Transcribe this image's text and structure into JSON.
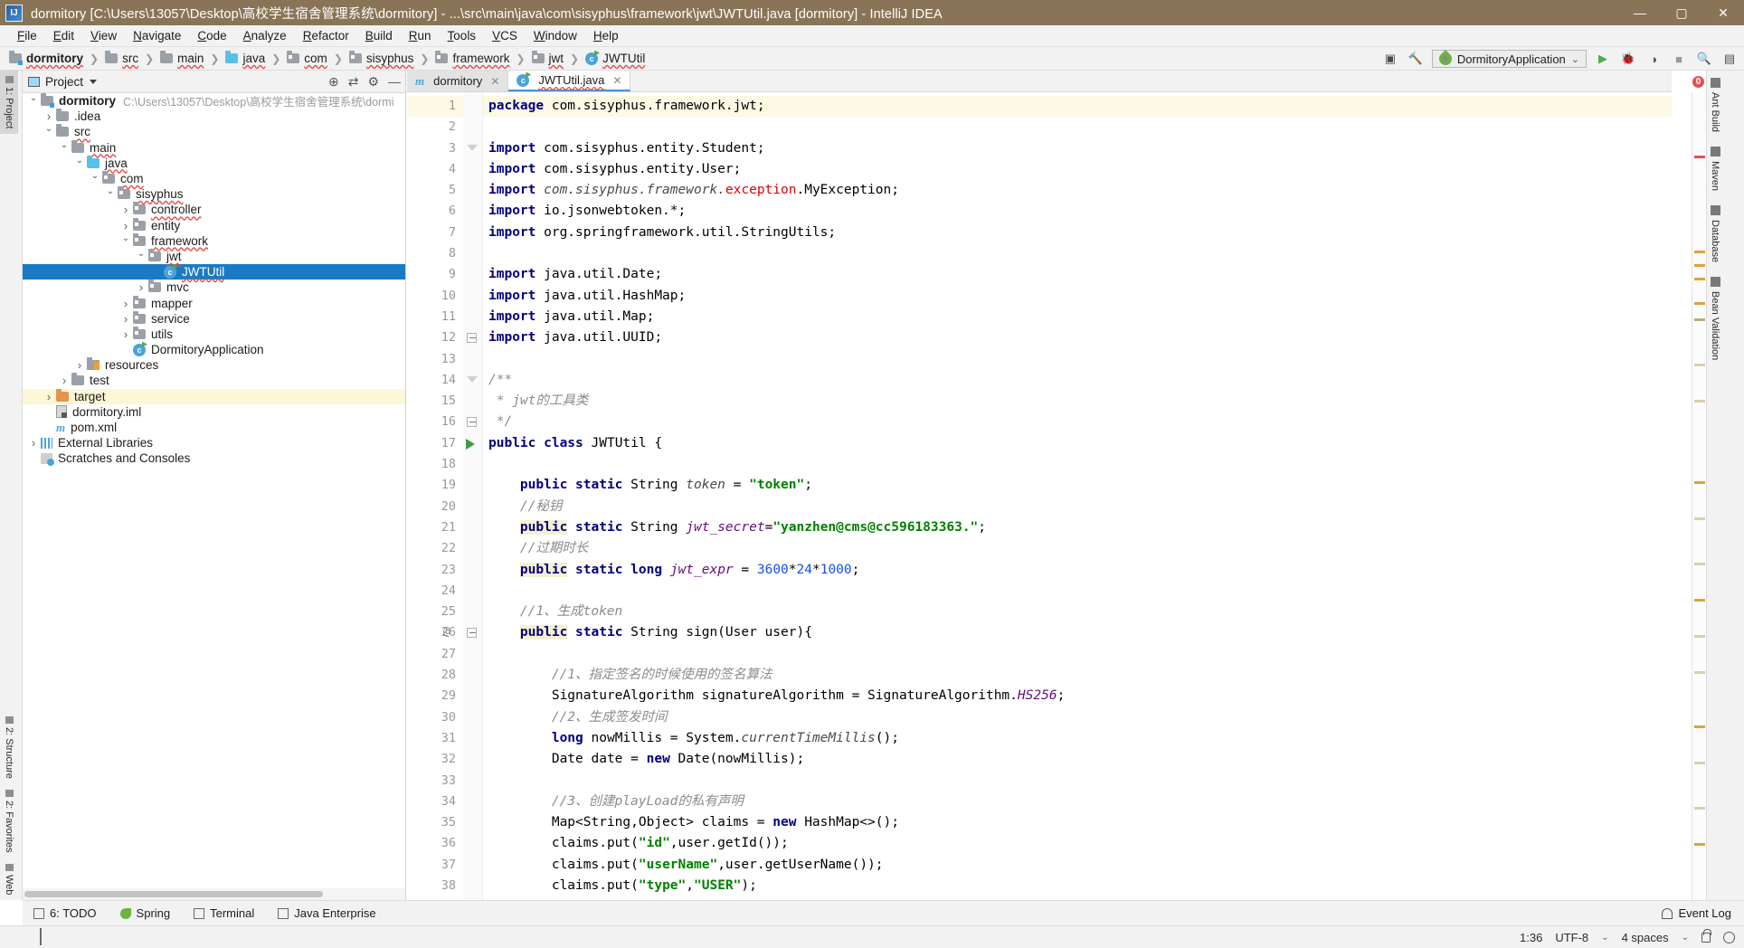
{
  "window": {
    "title": "dormitory [C:\\Users\\13057\\Desktop\\高校学生宿舍管理系统\\dormitory] - ...\\src\\main\\java\\com\\sisyphus\\framework\\jwt\\JWTUtil.java [dormitory] - IntelliJ IDEA",
    "logo": "IJ",
    "minimize": "—",
    "maximize": "▢",
    "close": "✕"
  },
  "menu": [
    "File",
    "Edit",
    "View",
    "Navigate",
    "Code",
    "Analyze",
    "Refactor",
    "Build",
    "Run",
    "Tools",
    "VCS",
    "Window",
    "Help"
  ],
  "breadcrumb": [
    {
      "label": "dormitory",
      "icon": "module-folder-icon",
      "bold": true
    },
    {
      "label": "src",
      "icon": "folder-icon",
      "bold": false
    },
    {
      "label": "main",
      "icon": "folder-icon",
      "bold": false
    },
    {
      "label": "java",
      "icon": "source-folder-icon",
      "bold": false
    },
    {
      "label": "com",
      "icon": "package-icon",
      "bold": false
    },
    {
      "label": "sisyphus",
      "icon": "package-icon",
      "bold": false
    },
    {
      "label": "framework",
      "icon": "package-icon",
      "bold": false
    },
    {
      "label": "jwt",
      "icon": "package-icon",
      "bold": false
    },
    {
      "label": "JWTUtil",
      "icon": "class-icon",
      "bold": false
    }
  ],
  "toolbar_right": {
    "run_config": "DormitoryApplication",
    "dropdown_caret": "⌄",
    "icons": [
      "build-icon",
      "hammer-icon",
      "run-icon",
      "debug-icon",
      "run-coverage-icon",
      "stop-icon",
      "search-icon",
      "project-structure-icon"
    ]
  },
  "left_strip": {
    "top": "1: Project",
    "bottom": [
      "2: Structure",
      "2: Favorites",
      "Web"
    ]
  },
  "project_panel": {
    "title": "Project",
    "header_icons": [
      "locate-icon",
      "collapse-all-icon",
      "gear-icon",
      "hide-icon"
    ],
    "tree": [
      {
        "indent": 0,
        "arrow": "open",
        "icon": "module-folder-icon",
        "label": "dormitory",
        "bold": true,
        "note": "C:\\Users\\13057\\Desktop\\高校学生宿舍管理系统\\dormi"
      },
      {
        "indent": 1,
        "arrow": "closed",
        "icon": "folder-icon",
        "label": ".idea"
      },
      {
        "indent": 1,
        "arrow": "open",
        "icon": "folder-icon",
        "label": "src",
        "squiggle": true
      },
      {
        "indent": 2,
        "arrow": "open",
        "icon": "folder-icon",
        "label": "main",
        "squiggle": true
      },
      {
        "indent": 3,
        "arrow": "open",
        "icon": "source-folder-icon",
        "label": "java",
        "squiggle": true
      },
      {
        "indent": 4,
        "arrow": "open",
        "icon": "package-icon",
        "label": "com",
        "squiggle": true
      },
      {
        "indent": 5,
        "arrow": "open",
        "icon": "package-icon",
        "label": "sisyphus",
        "squiggle": true
      },
      {
        "indent": 6,
        "arrow": "closed",
        "icon": "package-icon",
        "label": "controller",
        "squiggle": true
      },
      {
        "indent": 6,
        "arrow": "closed",
        "icon": "package-icon",
        "label": "entity"
      },
      {
        "indent": 6,
        "arrow": "open",
        "icon": "package-icon",
        "label": "framework",
        "squiggle": true
      },
      {
        "indent": 7,
        "arrow": "open",
        "icon": "package-icon",
        "label": "jwt",
        "squiggle": true
      },
      {
        "indent": 8,
        "arrow": "none",
        "icon": "class-icon",
        "label": "JWTUtil",
        "selected": true,
        "squiggle": true
      },
      {
        "indent": 7,
        "arrow": "closed",
        "icon": "package-icon",
        "label": "mvc"
      },
      {
        "indent": 6,
        "arrow": "closed",
        "icon": "package-icon",
        "label": "mapper"
      },
      {
        "indent": 6,
        "arrow": "closed",
        "icon": "package-icon",
        "label": "service"
      },
      {
        "indent": 6,
        "arrow": "closed",
        "icon": "package-icon",
        "label": "utils"
      },
      {
        "indent": 6,
        "arrow": "none",
        "icon": "spring-class-icon",
        "label": "DormitoryApplication"
      },
      {
        "indent": 3,
        "arrow": "closed",
        "icon": "resources-folder-icon",
        "label": "resources"
      },
      {
        "indent": 2,
        "arrow": "closed",
        "icon": "folder-icon",
        "label": "test"
      },
      {
        "indent": 1,
        "arrow": "closed",
        "icon": "target-folder-icon",
        "label": "target",
        "highlight": true
      },
      {
        "indent": 1,
        "arrow": "none",
        "icon": "iml-file-icon",
        "label": "dormitory.iml"
      },
      {
        "indent": 1,
        "arrow": "none",
        "icon": "maven-file-icon",
        "label": "pom.xml"
      },
      {
        "indent": 0,
        "arrow": "closed",
        "icon": "external-libraries-icon",
        "label": "External Libraries"
      },
      {
        "indent": 0,
        "arrow": "none",
        "icon": "scratches-icon",
        "label": "Scratches and Consoles"
      }
    ]
  },
  "editor": {
    "tabs": [
      {
        "label": "dormitory",
        "icon": "maven-file-icon",
        "active": false,
        "close": "✕"
      },
      {
        "label": "JWTUtil.java",
        "icon": "class-icon",
        "active": true,
        "close": "✕"
      }
    ],
    "first_line": 1,
    "lines": [
      {
        "n": 1,
        "hl": true,
        "fold": "none",
        "tokens": [
          {
            "t": "package ",
            "c": "kw"
          },
          {
            "t": "com.sisyphus.framework.jwt;",
            "c": "pln"
          }
        ]
      },
      {
        "n": 2,
        "fold": "none",
        "tokens": []
      },
      {
        "n": 3,
        "fold": "tri",
        "tokens": [
          {
            "t": "import ",
            "c": "kw"
          },
          {
            "t": "com.sisyphus.entity.Student;",
            "c": "pln"
          }
        ]
      },
      {
        "n": 4,
        "fold": "none",
        "tokens": [
          {
            "t": "import ",
            "c": "kw"
          },
          {
            "t": "com.sisyphus.entity.User;",
            "c": "pln"
          }
        ]
      },
      {
        "n": 5,
        "fold": "none",
        "tokens": [
          {
            "t": "import ",
            "c": "kw"
          },
          {
            "t": "com.sisyphus.framework.",
            "c": "stat"
          },
          {
            "t": "exception",
            "c": "err"
          },
          {
            "t": ".MyException;",
            "c": "pln"
          }
        ]
      },
      {
        "n": 6,
        "fold": "none",
        "tokens": [
          {
            "t": "import ",
            "c": "kw"
          },
          {
            "t": "io.jsonwebtoken.*;",
            "c": "pln"
          }
        ]
      },
      {
        "n": 7,
        "fold": "none",
        "tokens": [
          {
            "t": "import ",
            "c": "kw"
          },
          {
            "t": "org.springframework.util.StringUtils;",
            "c": "pln"
          }
        ]
      },
      {
        "n": 8,
        "fold": "none",
        "tokens": []
      },
      {
        "n": 9,
        "fold": "none",
        "tokens": [
          {
            "t": "import ",
            "c": "kw"
          },
          {
            "t": "java.util.Date;",
            "c": "pln"
          }
        ]
      },
      {
        "n": 10,
        "fold": "none",
        "tokens": [
          {
            "t": "import ",
            "c": "kw"
          },
          {
            "t": "java.util.HashMap;",
            "c": "pln"
          }
        ]
      },
      {
        "n": 11,
        "fold": "none",
        "tokens": [
          {
            "t": "import ",
            "c": "kw"
          },
          {
            "t": "java.util.Map;",
            "c": "pln"
          }
        ]
      },
      {
        "n": 12,
        "fold": "minus",
        "tokens": [
          {
            "t": "import ",
            "c": "kw"
          },
          {
            "t": "java.util.UUID;",
            "c": "pln"
          }
        ]
      },
      {
        "n": 13,
        "fold": "none",
        "tokens": []
      },
      {
        "n": 14,
        "fold": "tri",
        "tokens": [
          {
            "t": "/**",
            "c": "cmt"
          }
        ]
      },
      {
        "n": 15,
        "fold": "none",
        "tokens": [
          {
            "t": " * jwt的工具类",
            "c": "cmt"
          }
        ]
      },
      {
        "n": 16,
        "fold": "minus",
        "tokens": [
          {
            "t": " */",
            "c": "cmt"
          }
        ]
      },
      {
        "n": 17,
        "fold": "run",
        "tokens": [
          {
            "t": "public class ",
            "c": "kw"
          },
          {
            "t": "JWTUtil {",
            "c": "pln"
          }
        ]
      },
      {
        "n": 18,
        "fold": "none",
        "tokens": []
      },
      {
        "n": 19,
        "fold": "none",
        "tokens": [
          {
            "t": "    ",
            "c": "pln"
          },
          {
            "t": "public static ",
            "c": "kw"
          },
          {
            "t": "String ",
            "c": "pln"
          },
          {
            "t": "token",
            "c": "stat"
          },
          {
            "t": " = ",
            "c": "pln"
          },
          {
            "t": "\"token\"",
            "c": "str"
          },
          {
            "t": ";",
            "c": "pln"
          }
        ]
      },
      {
        "n": 20,
        "fold": "none",
        "tokens": [
          {
            "t": "    ",
            "c": "pln"
          },
          {
            "t": "//秘钥",
            "c": "cmt"
          }
        ]
      },
      {
        "n": 21,
        "fold": "none",
        "tokens": [
          {
            "t": "    ",
            "c": "pln"
          },
          {
            "t": "public",
            "c": "kw hlw"
          },
          {
            "t": " ",
            "c": "pln"
          },
          {
            "t": "static ",
            "c": "kw"
          },
          {
            "t": "String ",
            "c": "pln"
          },
          {
            "t": "jwt_secret",
            "c": "fld"
          },
          {
            "t": "=",
            "c": "pln"
          },
          {
            "t": "\"yanzhen@cms@cc596183363.\"",
            "c": "str"
          },
          {
            "t": ";",
            "c": "pln"
          }
        ]
      },
      {
        "n": 22,
        "fold": "none",
        "tokens": [
          {
            "t": "    ",
            "c": "pln"
          },
          {
            "t": "//过期时长",
            "c": "cmt"
          }
        ]
      },
      {
        "n": 23,
        "fold": "none",
        "tokens": [
          {
            "t": "    ",
            "c": "pln"
          },
          {
            "t": "public",
            "c": "kw hlw"
          },
          {
            "t": " ",
            "c": "pln"
          },
          {
            "t": "static long ",
            "c": "kw"
          },
          {
            "t": "jwt_expr",
            "c": "fld"
          },
          {
            "t": " = ",
            "c": "pln"
          },
          {
            "t": "3600",
            "c": "num"
          },
          {
            "t": "*",
            "c": "pln"
          },
          {
            "t": "24",
            "c": "num"
          },
          {
            "t": "*",
            "c": "pln"
          },
          {
            "t": "1000",
            "c": "num"
          },
          {
            "t": ";",
            "c": "pln"
          }
        ]
      },
      {
        "n": 24,
        "fold": "none",
        "tokens": []
      },
      {
        "n": 25,
        "fold": "none",
        "tokens": [
          {
            "t": "    ",
            "c": "pln"
          },
          {
            "t": "//1、生成token",
            "c": "cmt"
          }
        ]
      },
      {
        "n": 26,
        "fold": "minus",
        "at": true,
        "tokens": [
          {
            "t": "    ",
            "c": "pln"
          },
          {
            "t": "public",
            "c": "kw hlw"
          },
          {
            "t": " ",
            "c": "pln"
          },
          {
            "t": "static ",
            "c": "kw"
          },
          {
            "t": "String sign(User user){",
            "c": "pln"
          }
        ]
      },
      {
        "n": 27,
        "fold": "none",
        "tokens": []
      },
      {
        "n": 28,
        "fold": "none",
        "tokens": [
          {
            "t": "        ",
            "c": "pln"
          },
          {
            "t": "//1、指定签名的时候使用的签名算法",
            "c": "cmt"
          }
        ]
      },
      {
        "n": 29,
        "fold": "none",
        "tokens": [
          {
            "t": "        SignatureAlgorithm signatureAlgorithm = SignatureAlgorithm.",
            "c": "pln"
          },
          {
            "t": "HS256",
            "c": "fld"
          },
          {
            "t": ";",
            "c": "pln"
          }
        ]
      },
      {
        "n": 30,
        "fold": "none",
        "tokens": [
          {
            "t": "        ",
            "c": "pln"
          },
          {
            "t": "//2、生成签发时间",
            "c": "cmt"
          }
        ]
      },
      {
        "n": 31,
        "fold": "none",
        "tokens": [
          {
            "t": "        ",
            "c": "pln"
          },
          {
            "t": "long ",
            "c": "kw"
          },
          {
            "t": "nowMillis = System.",
            "c": "pln"
          },
          {
            "t": "currentTimeMillis",
            "c": "stat"
          },
          {
            "t": "();",
            "c": "pln"
          }
        ]
      },
      {
        "n": 32,
        "fold": "none",
        "tokens": [
          {
            "t": "        Date date = ",
            "c": "pln"
          },
          {
            "t": "new ",
            "c": "kw"
          },
          {
            "t": "Date(nowMillis);",
            "c": "pln"
          }
        ]
      },
      {
        "n": 33,
        "fold": "none",
        "tokens": []
      },
      {
        "n": 34,
        "fold": "none",
        "tokens": [
          {
            "t": "        ",
            "c": "pln"
          },
          {
            "t": "//3、创建playLoad的私有声明",
            "c": "cmt"
          }
        ]
      },
      {
        "n": 35,
        "fold": "none",
        "tokens": [
          {
            "t": "        Map<String,Object> claims = ",
            "c": "pln"
          },
          {
            "t": "new ",
            "c": "kw"
          },
          {
            "t": "HashMap<>();",
            "c": "pln"
          }
        ]
      },
      {
        "n": 36,
        "fold": "none",
        "tokens": [
          {
            "t": "        claims.put(",
            "c": "pln"
          },
          {
            "t": "\"id\"",
            "c": "str"
          },
          {
            "t": ",user.getId());",
            "c": "pln"
          }
        ]
      },
      {
        "n": 37,
        "fold": "none",
        "tokens": [
          {
            "t": "        claims.put(",
            "c": "pln"
          },
          {
            "t": "\"userName\"",
            "c": "str"
          },
          {
            "t": ",user.getUserName());",
            "c": "pln"
          }
        ]
      },
      {
        "n": 38,
        "fold": "none",
        "tokens": [
          {
            "t": "        claims.put(",
            "c": "pln"
          },
          {
            "t": "\"type\"",
            "c": "str"
          },
          {
            "t": ",",
            "c": "pln"
          },
          {
            "t": "\"USER\"",
            "c": "str"
          },
          {
            "t": ");",
            "c": "pln"
          }
        ]
      }
    ],
    "error_count": "0"
  },
  "right_strip": [
    {
      "label": "Ant Build",
      "icon": "ant-icon"
    },
    {
      "label": "Maven",
      "icon": "maven-icon"
    },
    {
      "label": "Database",
      "icon": "database-icon"
    },
    {
      "label": "Bean Validation",
      "icon": "bean-icon"
    }
  ],
  "tool_windows": [
    {
      "label": "6: TODO",
      "icon": "todo-icon"
    },
    {
      "label": "Spring",
      "icon": "spring-icon"
    },
    {
      "label": "Terminal",
      "icon": "terminal-icon"
    },
    {
      "label": "Java Enterprise",
      "icon": "java-enterprise-icon"
    }
  ],
  "event_log": "Event Log",
  "status_bar": {
    "caret": "1:36",
    "encoding": "UTF-8",
    "indent": "4 spaces",
    "separator": "⌄"
  }
}
